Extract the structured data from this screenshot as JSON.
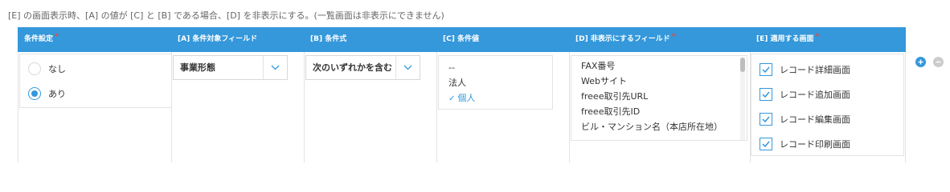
{
  "note": "[E] の画面表示時、[A] の値が [C] と [B] である場合、[D] を非表示にする。(一覧画面は非表示にできません)",
  "headers": {
    "condition_setting": "条件設定",
    "field_a": "[A] 条件対象フィールド",
    "expression_b": "[B] 条件式",
    "value_c": "[C] 条件値",
    "hidden_d": "[D] 非表示にするフィールド",
    "screens_e": "[E] 適用する画面",
    "required_mark": "*"
  },
  "condition_options": [
    {
      "label": "なし",
      "selected": false
    },
    {
      "label": "あり",
      "selected": true
    }
  ],
  "field_a": {
    "value": "事業形態"
  },
  "expression_b": {
    "value": "次のいずれかを含む"
  },
  "values_c": [
    {
      "label": "--",
      "selected": false
    },
    {
      "label": "法人",
      "selected": false
    },
    {
      "label": "個人",
      "selected": true,
      "mark": "✓"
    }
  ],
  "hidden_fields": [
    "FAX番号",
    "Webサイト",
    "freee取引先URL",
    "freee取引先ID",
    "ビル・マンション名（本店所在地）"
  ],
  "screens": [
    {
      "label": "レコード詳細画面",
      "checked": true
    },
    {
      "label": "レコード追加画面",
      "checked": true
    },
    {
      "label": "レコード編集画面",
      "checked": true
    },
    {
      "label": "レコード印刷画面",
      "checked": true
    }
  ],
  "colors": {
    "accent": "#3498db",
    "required": "#e74c3c",
    "remove": "#cccccc"
  },
  "icons": {
    "add": "plus-circle-icon",
    "remove": "minus-circle-icon",
    "dropdown": "chevron-down-icon",
    "check": "checkmark-icon"
  }
}
